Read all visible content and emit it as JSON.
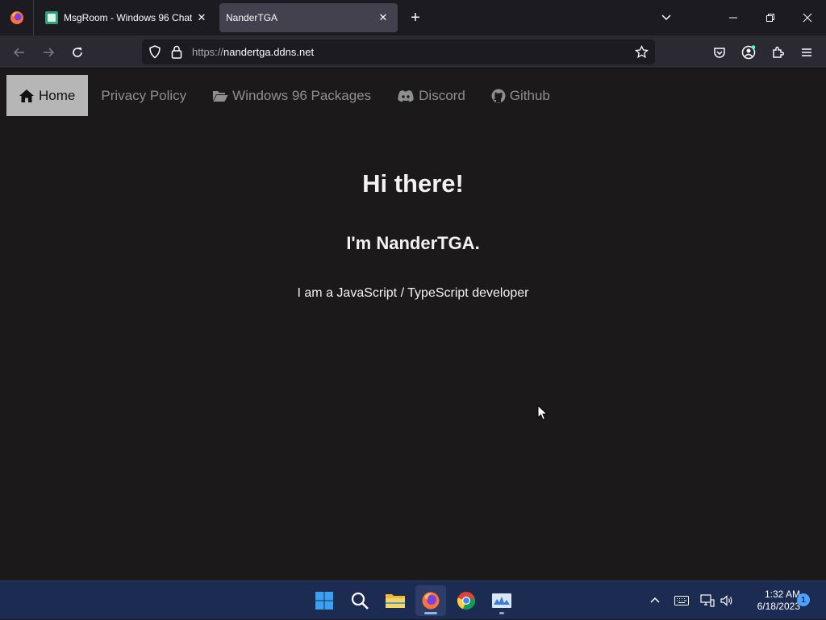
{
  "browser": {
    "tabs": [
      {
        "title": "MsgRoom - Windows 96 Chat",
        "active": false
      },
      {
        "title": "NanderTGA",
        "active": true
      }
    ],
    "url_scheme": "https://",
    "url_host": "nandertga.ddns.net"
  },
  "site": {
    "nav": [
      {
        "label": "Home",
        "icon": "home-icon",
        "active": true
      },
      {
        "label": "Privacy Policy",
        "icon": "",
        "active": false
      },
      {
        "label": "Windows 96 Packages",
        "icon": "folder-open-icon",
        "active": false
      },
      {
        "label": "Discord",
        "icon": "discord-icon",
        "active": false
      },
      {
        "label": "Github",
        "icon": "github-icon",
        "active": false
      }
    ],
    "heading": "Hi there!",
    "subheading": "I'm NanderTGA.",
    "description": "I am a JavaScript / TypeScript developer"
  },
  "taskbar": {
    "time": "1:32 AM",
    "date": "6/18/2023",
    "notification_count": "1"
  },
  "colors": {
    "page_bg": "#1c191a",
    "active_nav_bg": "#b6b6b6",
    "taskbar_bg": "#1b2b52"
  }
}
